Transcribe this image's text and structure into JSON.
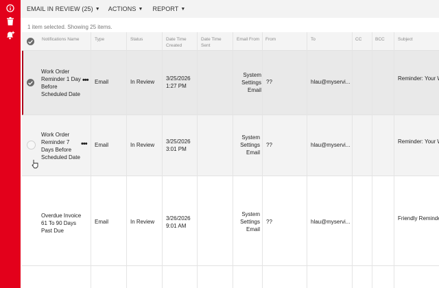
{
  "toolbar": {
    "email_in_review": "EMAIL IN REVIEW (25)",
    "actions": "ACTIONS",
    "report": "REPORT"
  },
  "status_line": "1 item selected. Showing 25 items.",
  "columns": {
    "notifications_name": "Notifications Name",
    "type": "Type",
    "status": "Status",
    "date_time_created": "Date Time Created",
    "date_time_sent": "Date Time Sent",
    "email_from": "Email From",
    "from": "From",
    "to": "To",
    "cc": "CC",
    "bcc": "BCC",
    "subject": "Subject"
  },
  "rows": [
    {
      "name": "Work Order Reminder 1 Day Before Scheduled Date",
      "type": "Email",
      "status": "In Review",
      "created": "3/25/2026 1:27 PM",
      "sent": "",
      "email_from": "System Settings Email",
      "from": "??",
      "to": "hlau@myservi...",
      "cc": "",
      "bcc": "",
      "subject": "Reminder: Your W... Scheduled For To...",
      "selected": true
    },
    {
      "name": "Work Order Reminder 7 Days Before Scheduled Date",
      "type": "Email",
      "status": "In Review",
      "created": "3/25/2026 3:01 PM",
      "sent": "",
      "email_from": "System Settings Email",
      "from": "??",
      "to": "hlau@myservi...",
      "cc": "",
      "bcc": "",
      "subject": "Reminder: Your W... {StartDateTime}",
      "selected": false
    },
    {
      "name": "Overdue Invoice 61 To 90 Days Past Due",
      "type": "Email",
      "status": "In Review",
      "created": "3/26/2026 9:01 AM",
      "sent": "",
      "email_from": "System Settings Email",
      "from": "??",
      "to": "hlau@myservi...",
      "cc": "",
      "bcc": "",
      "subject": "Friendly Reminde... {InvoiceDueDate}",
      "selected": false
    }
  ],
  "icons": {
    "rail": [
      "info-icon",
      "trash-icon",
      "bell-plus-icon"
    ],
    "accent": "#e3001b"
  }
}
